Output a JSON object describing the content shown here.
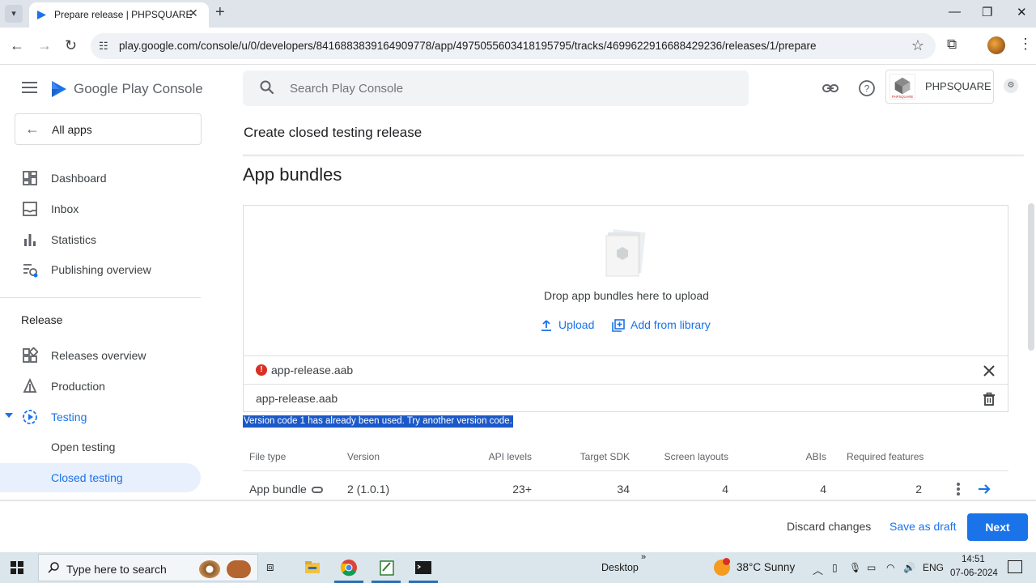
{
  "browser": {
    "tab_title": "Prepare release | PHPSQUARE",
    "url": "play.google.com/console/u/0/developers/8416883839164909778/app/4975055603418195795/tracks/4699622916688429236/releases/1/prepare"
  },
  "header": {
    "app_name": "Google Play Console",
    "search_placeholder": "Search Play Console",
    "account_name": "PHPSQUARE",
    "account_logo_text": "PHPSQUARE"
  },
  "sidebar": {
    "all_apps": "All apps",
    "items": [
      {
        "label": "Dashboard",
        "icon": "dashboard-icon"
      },
      {
        "label": "Inbox",
        "icon": "inbox-icon"
      },
      {
        "label": "Statistics",
        "icon": "bar-chart-icon"
      },
      {
        "label": "Publishing overview",
        "icon": "publishing-icon"
      }
    ],
    "release_section": "Release",
    "release_items": [
      {
        "label": "Releases overview",
        "icon": "releases-overview-icon"
      },
      {
        "label": "Production",
        "icon": "production-icon"
      },
      {
        "label": "Testing",
        "icon": "testing-icon"
      },
      {
        "label": "Open testing"
      },
      {
        "label": "Closed testing"
      }
    ]
  },
  "main": {
    "page_title": "Create closed testing release",
    "section_title": "App bundles",
    "drop_text": "Drop app bundles here to upload",
    "upload_label": "Upload",
    "library_label": "Add from library",
    "files": [
      {
        "name": "app-release.aab",
        "status": "error",
        "action": "close"
      },
      {
        "name": "app-release.aab",
        "status": "ok",
        "action": "delete"
      }
    ],
    "error_message": "Version code 1 has already been used. Try another version code.",
    "table": {
      "headers": [
        "File type",
        "Version",
        "API levels",
        "Target SDK",
        "Screen layouts",
        "ABIs",
        "Required features"
      ],
      "rows": [
        {
          "file_type": "App bundle",
          "version": "2 (1.0.1)",
          "api_levels": "23+",
          "target_sdk": "34",
          "screen_layouts": "4",
          "abis": "4",
          "required_features": "2"
        }
      ]
    }
  },
  "footer": {
    "discard": "Discard changes",
    "save_draft": "Save as draft",
    "next": "Next"
  },
  "taskbar": {
    "search_text": "Type here to search",
    "desktop_label": "Desktop",
    "weather": "38°C  Sunny",
    "language": "ENG",
    "time": "14:51",
    "date": "07-06-2024"
  },
  "colors": {
    "accent": "#1a73e8",
    "error": "#d93025",
    "selection": "#1c59c8"
  }
}
